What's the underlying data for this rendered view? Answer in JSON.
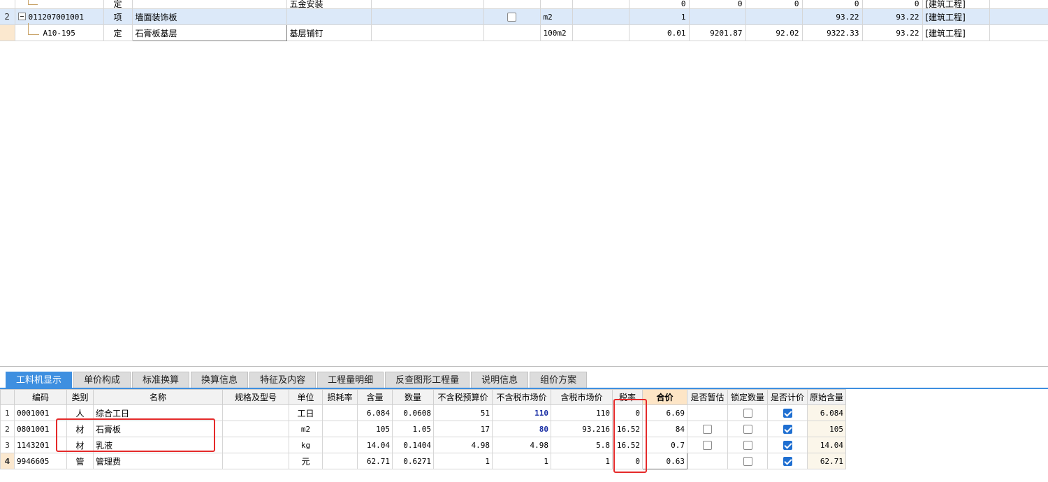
{
  "top_grid": {
    "rows": [
      {
        "idx": "",
        "code": "",
        "type": "定",
        "name": "",
        "desc": "五金安装",
        "spec": "",
        "cb": false,
        "unit": "",
        "extra": "",
        "qty": "0",
        "c1": "0",
        "c2": "0",
        "c3": "0",
        "c4": "0",
        "prof": "[建筑工程]"
      },
      {
        "idx": "2",
        "code": "011207001001",
        "type": "项",
        "name": "墙面装饰板",
        "desc": "",
        "spec": "",
        "cb": true,
        "unit": "m2",
        "extra": "",
        "qty": "1",
        "c1": "",
        "c2": "",
        "c3": "93.22",
        "c4": "93.22",
        "prof": "[建筑工程]"
      },
      {
        "idx": "",
        "code": "A10-195",
        "type": "定",
        "name": "石膏板基层",
        "desc": "基层铺钉",
        "spec": "",
        "cb": false,
        "unit": "100m2",
        "extra": "",
        "qty": "0.01",
        "c1": "9201.87",
        "c2": "92.02",
        "c3": "9322.33",
        "c4": "93.22",
        "prof": "[建筑工程]"
      }
    ]
  },
  "tabs": [
    "工料机显示",
    "单价构成",
    "标准换算",
    "换算信息",
    "特征及内容",
    "工程量明细",
    "反查图形工程量",
    "说明信息",
    "组价方案"
  ],
  "bottom_grid": {
    "headers": [
      "编码",
      "类别",
      "名称",
      "规格及型号",
      "单位",
      "损耗率",
      "含量",
      "数量",
      "不含税预算价",
      "不含税市场价",
      "含税市场价",
      "税率",
      "合价",
      "是否暂估",
      "锁定数量",
      "是否计价",
      "原始含量"
    ],
    "rows": [
      {
        "idx": "1",
        "code": "0001001",
        "cat": "人",
        "name": "综合工日",
        "spec": "",
        "unit": "工日",
        "loss": "",
        "content": "6.084",
        "qty": "0.0608",
        "budget": "51",
        "market": "110",
        "tax_market": "110",
        "tax_rate": "0",
        "total": "6.69",
        "estimate": null,
        "lock": false,
        "priced": true,
        "orig": "6.084"
      },
      {
        "idx": "2",
        "code": "0801001",
        "cat": "材",
        "name": "石膏板",
        "spec": "",
        "unit": "m2",
        "loss": "",
        "content": "105",
        "qty": "1.05",
        "budget": "17",
        "market": "80",
        "tax_market": "93.216",
        "tax_rate": "16.52",
        "total": "84",
        "estimate": false,
        "lock": false,
        "priced": true,
        "orig": "105"
      },
      {
        "idx": "3",
        "code": "1143201",
        "cat": "材",
        "name": "乳液",
        "spec": "",
        "unit": "kg",
        "loss": "",
        "content": "14.04",
        "qty": "0.1404",
        "budget": "4.98",
        "market": "4.98",
        "tax_market": "5.8",
        "tax_rate": "16.52",
        "total": "0.7",
        "estimate": false,
        "lock": false,
        "priced": true,
        "orig": "14.04"
      },
      {
        "idx": "4",
        "code": "9946605",
        "cat": "管",
        "name": "管理费",
        "spec": "",
        "unit": "元",
        "loss": "",
        "content": "62.71",
        "qty": "0.6271",
        "budget": "1",
        "market": "1",
        "tax_market": "1",
        "tax_rate": "0",
        "total": "0.63",
        "estimate": null,
        "lock": false,
        "priced": true,
        "orig": "62.71"
      }
    ]
  },
  "colors": {
    "tab_active": "#3e8fe0",
    "highlight": "#e52a2a",
    "selected_row": "#dce9f9",
    "blue_value": "#1a2fa5"
  }
}
